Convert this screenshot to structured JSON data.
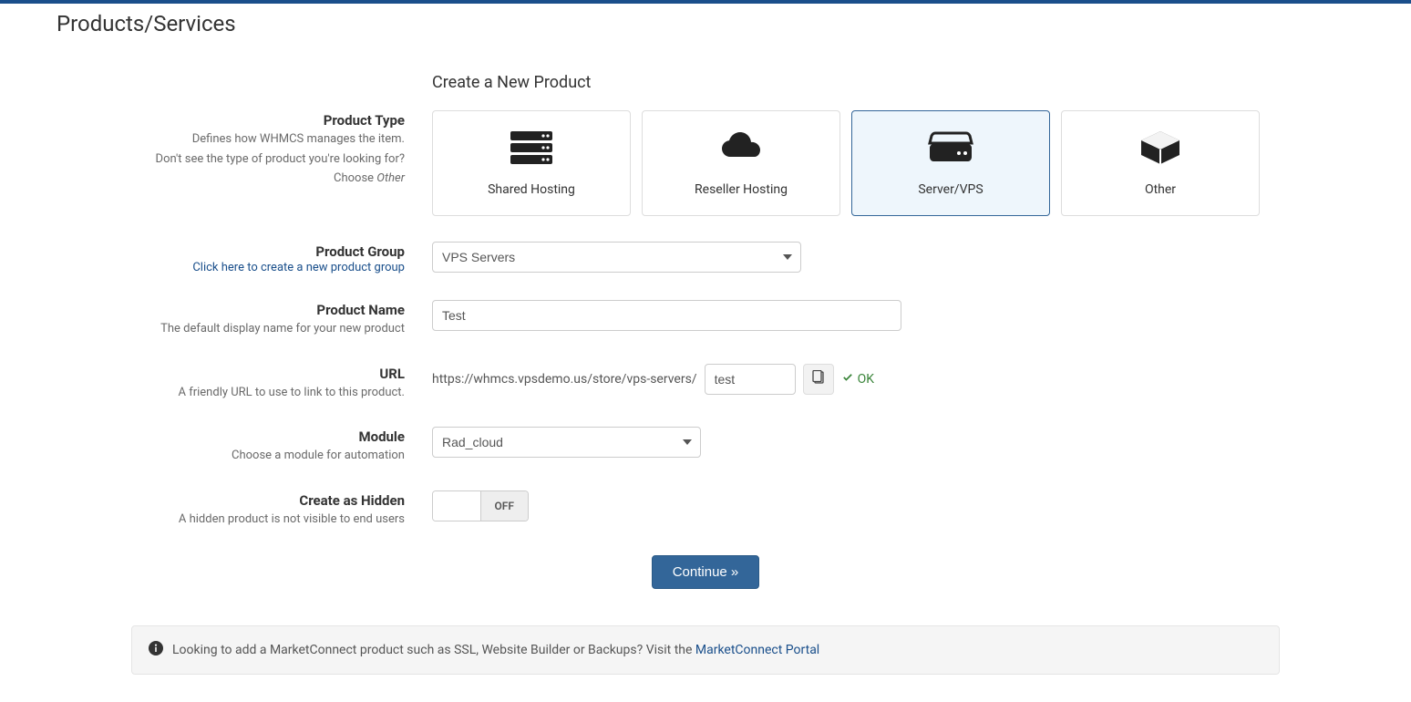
{
  "page_title": "Products/Services",
  "section_title": "Create a New Product",
  "labels": {
    "product_type": "Product Type",
    "product_type_hint1": "Defines how WHMCS manages the item.",
    "product_type_hint2": "Don't see the type of product you're looking for?",
    "product_type_hint3_prefix": "Choose ",
    "product_type_hint3_em": "Other",
    "product_group": "Product Group",
    "product_group_link": "Click here to create a new product group",
    "product_name": "Product Name",
    "product_name_hint": "The default display name for your new product",
    "url": "URL",
    "url_hint": "A friendly URL to use to link to this product.",
    "module": "Module",
    "module_hint": "Choose a module for automation",
    "hidden": "Create as Hidden",
    "hidden_hint": "A hidden product is not visible to end users"
  },
  "product_types": [
    {
      "key": "shared",
      "label": "Shared Hosting",
      "icon": "server-icon",
      "selected": false
    },
    {
      "key": "reseller",
      "label": "Reseller Hosting",
      "icon": "cloud-icon",
      "selected": false
    },
    {
      "key": "vps",
      "label": "Server/VPS",
      "icon": "hdd-icon",
      "selected": true
    },
    {
      "key": "other",
      "label": "Other",
      "icon": "cube-icon",
      "selected": false
    }
  ],
  "product_group": {
    "selected": "VPS Servers"
  },
  "product_name": {
    "value": "Test"
  },
  "url": {
    "base": "https://whmcs.vpsdemo.us/store/vps-servers/",
    "slug": "test",
    "status": "OK"
  },
  "module": {
    "selected": "Rad_cloud"
  },
  "hidden_toggle": {
    "state": "OFF"
  },
  "actions": {
    "continue": "Continue »"
  },
  "banner": {
    "text": "Looking to add a MarketConnect product such as SSL, Website Builder or Backups? Visit the ",
    "link": "MarketConnect Portal"
  }
}
